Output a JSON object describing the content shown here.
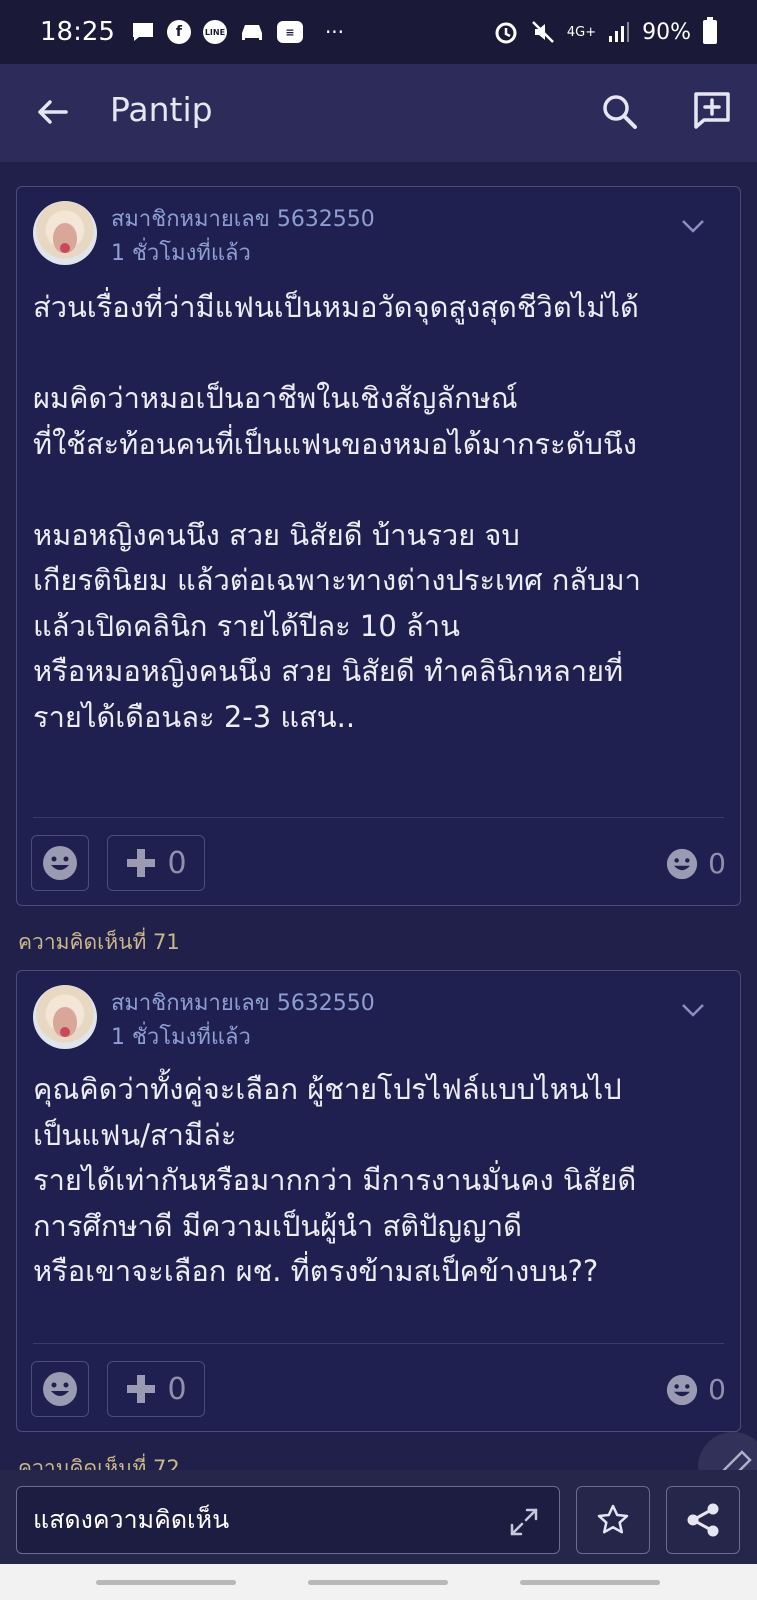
{
  "status_bar": {
    "time": "18:25",
    "battery": "90%",
    "network": "4G+",
    "more": "···"
  },
  "app_bar": {
    "title": "Pantip"
  },
  "colors": {
    "background": "#21204a",
    "card": "#202050",
    "accent_label": "#c9b888",
    "member_text": "#8d9fd2"
  },
  "comments": [
    {
      "member": "สมาชิกหมายเลข 5632550",
      "time_ago": "1 ชั่วโมงที่แล้ว",
      "body": "ส่วนเรื่องที่ว่ามีแฟนเป็นหมอวัดจุดสูงสุดชีวิตไม่ได้\n\nผมคิดว่าหมอเป็นอาชีพในเชิงสัญลักษณ์\nที่ใช้สะท้อนคนที่เป็นแฟนของหมอได้มากระดับนึง\n\nหมอหญิงคนนึง สวย นิสัยดี บ้านรวย จบ\nเกียรตินิยม แล้วต่อเฉพาะทางต่างประเทศ กลับมา\nแล้วเปิดคลินิก รายได้ปีละ 10 ล้าน\nหรือหมอหญิงคนนึง สวย นิสัยดี ทำคลินิกหลายที่\nรายได้เดือนละ 2-3 แสน..",
      "plus_count": "0",
      "emoji_count": "0"
    },
    {
      "label": "ความคิดเห็นที่ 71",
      "member": "สมาชิกหมายเลข 5632550",
      "time_ago": "1 ชั่วโมงที่แล้ว",
      "body": "คุณคิดว่าทั้งคู่จะเลือก ผู้ชายโปรไฟล์แบบไหนไป\nเป็นแฟน/สามีล่ะ\nรายได้เท่ากันหรือมากกว่า มีการงานมั่นคง นิสัยดี\nการศึกษาดี มีความเป็นผู้นำ สติปัญญาดี\nหรือเขาจะเลือก ผช. ที่ตรงข้ามสเป็คข้างบน??",
      "plus_count": "0",
      "emoji_count": "0"
    }
  ],
  "next_comment_label": "ความคิดเห็นที่ 72",
  "bottom_bar": {
    "comment_placeholder": "แสดงความคิดเห็น"
  },
  "icons": [
    "back-arrow-icon",
    "search-icon",
    "compose-icon",
    "chevron-down-icon",
    "emoji-icon",
    "plus-icon",
    "expand-icon",
    "star-icon",
    "share-icon",
    "edit-icon"
  ]
}
